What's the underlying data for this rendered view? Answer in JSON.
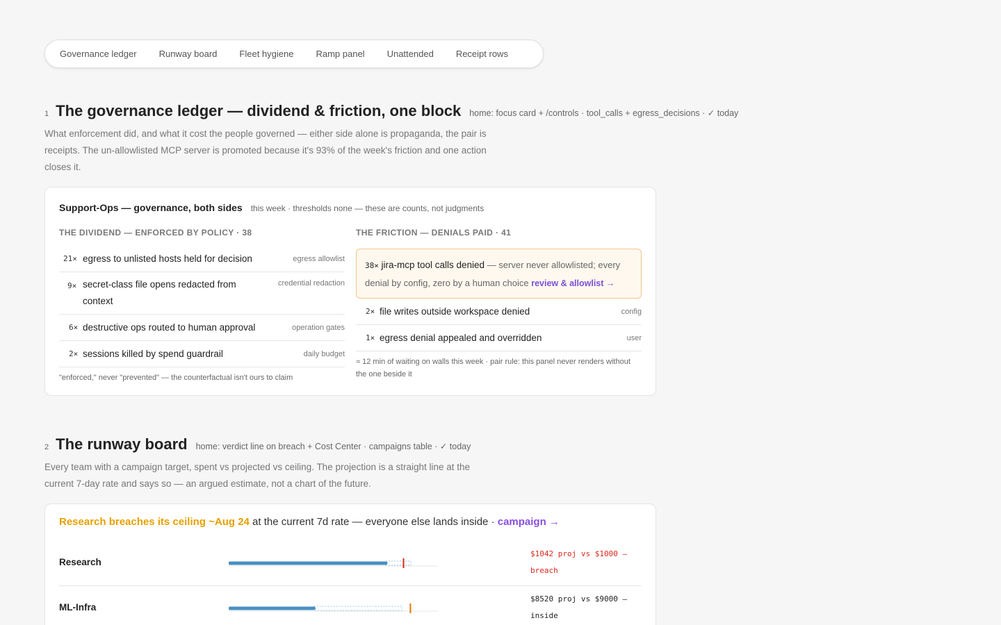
{
  "tabs": [
    "Governance ledger",
    "Runway board",
    "Fleet hygiene",
    "Ramp panel",
    "Unattended",
    "Receipt rows"
  ],
  "governance": {
    "number": "1",
    "title": "The governance ledger — dividend & friction, one block",
    "meta": "home: focus card + /controls · tool_calls + egress_decisions · ✓ today",
    "description": "What enforcement did, and what it cost the people governed — either side alone is propaganda, the pair is receipts. The un-allowlisted MCP server is promoted because it's 93% of the week's friction and one action closes it.",
    "card": {
      "title": "Support-Ops — governance, both sides",
      "meta": "this week · thresholds none — these are counts, not judgments",
      "dividend": {
        "heading": "THE DIVIDEND — ENFORCED BY POLICY · 38",
        "rows": [
          {
            "count": "21×",
            "text": "egress to unlisted hosts held for decision",
            "tag": "egress allowlist"
          },
          {
            "count": "9×",
            "text": "secret-class file opens redacted from context",
            "tag": "credential redaction"
          },
          {
            "count": "6×",
            "text": "destructive ops routed to human approval",
            "tag": "operation gates"
          },
          {
            "count": "2×",
            "text": "sessions killed by spend guardrail",
            "tag": "daily budget"
          }
        ],
        "footnote": "\"enforced,\" never \"prevented\" — the counterfactual isn't ours to claim"
      },
      "friction": {
        "heading": "THE FRICTION — DENIALS PAID · 41",
        "highlight": {
          "count": "38×",
          "name": "jira-mcp tool calls denied",
          "detail": " — server never allowlisted; every denial by config, zero by a human choice ",
          "link": "review & allowlist →"
        },
        "rows": [
          {
            "count": "2×",
            "text": "file writes outside workspace denied",
            "tag": "config"
          },
          {
            "count": "1×",
            "text": "egress denial appealed and overridden",
            "tag": "user"
          }
        ],
        "footnote": "≈ 12 min of waiting on walls this week · pair rule: this panel never renders without the one beside it"
      }
    }
  },
  "runway": {
    "number": "2",
    "title": "The runway board",
    "meta": "home: verdict line on breach + Cost Center · campaigns table · ✓ today",
    "description": "Every team with a campaign target, spent vs projected vs ceiling. The projection is a straight line at the current 7-day rate and says so — an argued estimate, not a chart of the future.",
    "headline": {
      "warning": "Research breaches its ceiling ~Aug 24",
      "middle": " at the current 7d rate — everyone else lands inside · ",
      "link": "campaign →"
    },
    "teams": [
      {
        "name": "Research",
        "spent_fraction": 0.75,
        "projected_fraction": 0.87,
        "ceiling_fraction": 0.835,
        "status": "breach",
        "note": "$1042 proj vs $1000 — breach",
        "note_color": "#d9261c",
        "ceiling_color": "#d9261c"
      },
      {
        "name": "ML-Infra",
        "spent_fraction": 0.405,
        "projected_fraction": 0.827,
        "ceiling_fraction": 0.868,
        "status": "inside",
        "note": "$8520 proj vs $9000 — inside",
        "note_color": "#222222",
        "ceiling_color": "#e07b00"
      }
    ],
    "colors": {
      "spent": "#4a90c2",
      "projected": "#9ec7e3",
      "track": "#e4e4e4"
    }
  }
}
